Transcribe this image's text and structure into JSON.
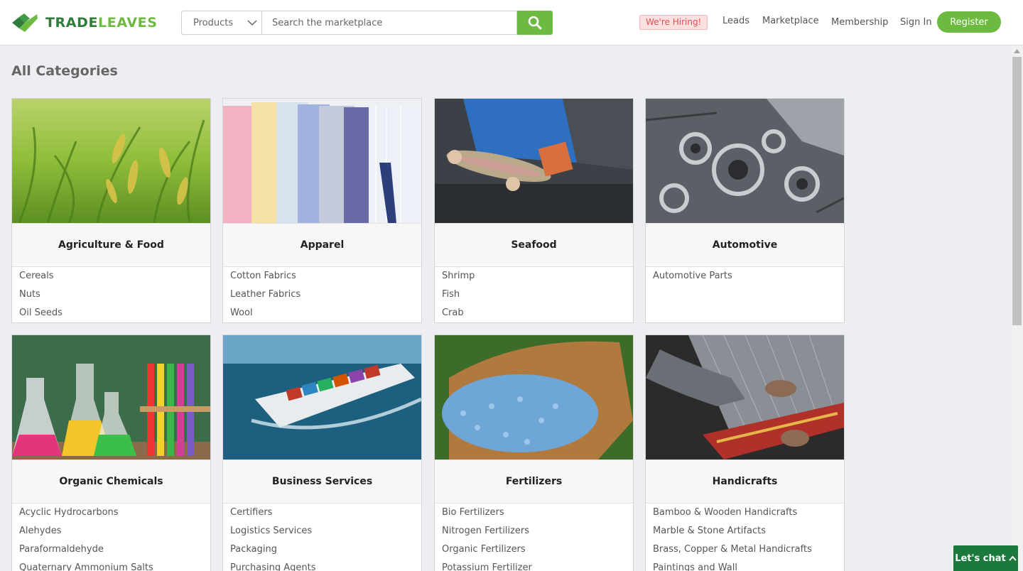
{
  "brand": {
    "part1": "TRADE",
    "part2": "LEAVES",
    "green_dark": "#2f7d3a",
    "green_light": "#6cba3f"
  },
  "search": {
    "category": "Products",
    "placeholder": "Search the marketplace"
  },
  "header": {
    "hiring": "We're Hiring!",
    "nav": [
      "Leads",
      "Marketplace",
      "Membership",
      "Sign In"
    ],
    "register": "Register"
  },
  "page": {
    "title": "All Categories"
  },
  "categories": [
    {
      "name": "Agriculture & Food",
      "items": [
        "Cereals",
        "Nuts",
        "Oil Seeds"
      ],
      "image": "rice-field"
    },
    {
      "name": "Apparel",
      "items": [
        "Cotton Fabrics",
        "Leather Fabrics",
        "Wool"
      ],
      "image": "shirts"
    },
    {
      "name": "Seafood",
      "items": [
        "Shrimp",
        "Fish",
        "Crab"
      ],
      "image": "fish-catch"
    },
    {
      "name": "Automotive",
      "items": [
        "Automotive Parts"
      ],
      "image": "engine"
    },
    {
      "name": "Organic Chemicals",
      "items": [
        "Acyclic Hydrocarbons",
        "Alehydes",
        "Paraformaldehyde",
        "Quaternary Ammonium Salts"
      ],
      "image": "lab-flasks"
    },
    {
      "name": "Business Services",
      "items": [
        "Certifiers",
        "Logistics Services",
        "Packaging",
        "Purchasing Agents"
      ],
      "image": "cargo-ship"
    },
    {
      "name": "Fertilizers",
      "items": [
        "Bio Fertilizers",
        "Nitrogen Fertilizers",
        "Organic Fertilizers",
        "Potassium Fertilizer"
      ],
      "image": "fertilizer-granules"
    },
    {
      "name": "Handicrafts",
      "items": [
        "Bamboo & Wooden Handicrafts",
        "Marble & Stone Artifacts",
        "Brass, Copper & Metal Handicrafts",
        "Paintings and Wall"
      ],
      "image": "weaving-loom"
    }
  ],
  "chat": {
    "label": "Let's chat"
  }
}
